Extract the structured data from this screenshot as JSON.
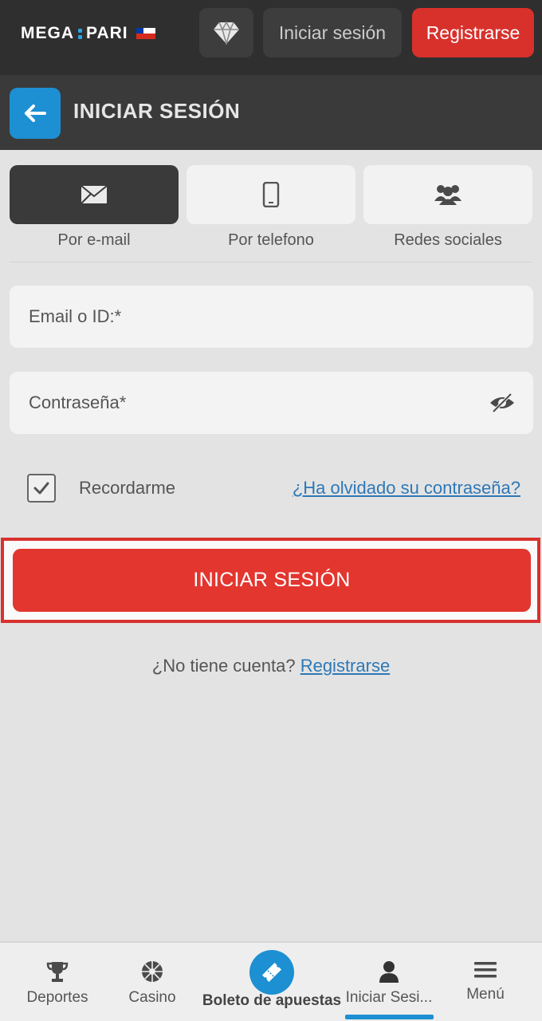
{
  "header": {
    "logo_left": "MEGA",
    "logo_right": "PARI",
    "login_label": "Iniciar sesión",
    "register_label": "Registrarse",
    "gem_icon": "diamond-icon"
  },
  "title_bar": {
    "title": "INICIAR SESIÓN",
    "back_icon": "arrow-left-icon"
  },
  "login_methods": [
    {
      "label": "Por e-mail",
      "icon": "envelope-icon",
      "active": true
    },
    {
      "label": "Por telefono",
      "icon": "phone-icon",
      "active": false
    },
    {
      "label": "Redes sociales",
      "icon": "people-icon",
      "active": false
    }
  ],
  "form": {
    "email_placeholder": "Email o ID:*",
    "password_placeholder": "Contraseña*",
    "remember_label": "Recordarme",
    "remember_checked": true,
    "forgot_link": "¿Ha olvidado su contraseña?",
    "submit_label": "INICIAR SESIÓN"
  },
  "signup_prompt": {
    "text": "¿No tiene cuenta?",
    "link": "Registrarse"
  },
  "bottom_nav": [
    {
      "label": "Deportes",
      "icon": "trophy-icon",
      "active": false
    },
    {
      "label": "Casino",
      "icon": "roulette-icon",
      "active": false
    },
    {
      "label": "Boleto de apuestas",
      "icon": "ticket-icon",
      "active": false
    },
    {
      "label": "Iniciar Sesi...",
      "icon": "user-icon",
      "active": true
    },
    {
      "label": "Menú",
      "icon": "hamburger-icon",
      "active": false
    }
  ],
  "colors": {
    "brand_red": "#e2362f",
    "accent_blue": "#1d8fd3",
    "header_dark": "#2f2f2f"
  }
}
